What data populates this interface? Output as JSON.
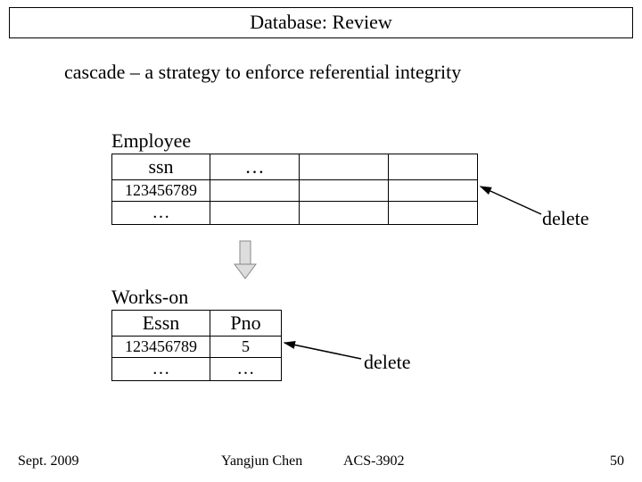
{
  "title": "Database: Review",
  "subtitle": "cascade – a strategy to enforce referential integrity",
  "employee": {
    "label": "Employee",
    "headers": [
      "ssn",
      "…",
      "",
      ""
    ],
    "rows": [
      [
        "123456789",
        "",
        "",
        ""
      ],
      [
        "…",
        "",
        "",
        ""
      ]
    ],
    "delete_label": "delete"
  },
  "works_on": {
    "label": "Works-on",
    "headers": [
      "Essn",
      "Pno"
    ],
    "rows": [
      [
        "123456789",
        "5"
      ],
      [
        "…",
        "…"
      ]
    ],
    "delete_label": "delete"
  },
  "footer": {
    "date": "Sept. 2009",
    "author": "Yangjun Chen",
    "course": "ACS-3902",
    "page": "50"
  }
}
